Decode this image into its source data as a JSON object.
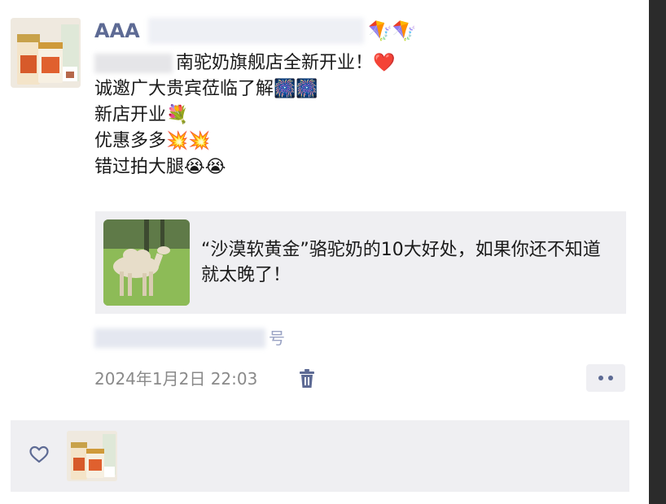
{
  "post": {
    "username": "AAA",
    "username_suffix": "🪁🪁",
    "lines": [
      "南驼奶旗舰店全新开业！❤️",
      "诚邀广大贵宾莅临了解🎆🎆",
      "新店开业💐",
      "优惠多多💥💥",
      "错过拍大腿😭😭"
    ]
  },
  "share_card": {
    "title": "“沙漠软黄金”骆驼奶的10大好处，如果你还不知道就太晚了！",
    "thumbnail_icon": "camel-photo"
  },
  "source": {
    "suffix": "号"
  },
  "meta": {
    "timestamp": "2024年1月2日 22:03",
    "delete_icon": "trash-icon",
    "more_icon": "more-dots-icon"
  },
  "likes": {
    "like_icon": "heart-outline-icon"
  },
  "colors": {
    "name_blue": "#5d6a94",
    "card_bg": "#efeff2",
    "timestamp_gray": "#8a8a8a"
  }
}
